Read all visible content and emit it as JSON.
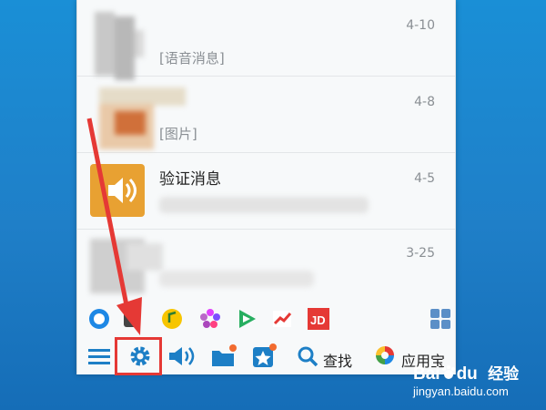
{
  "conversations": [
    {
      "date": "4-10",
      "preview": "[语音消息]"
    },
    {
      "date": "4-8",
      "preview": "[图片]"
    },
    {
      "date": "4-5",
      "title": "验证消息",
      "preview": ""
    },
    {
      "date": "3-25",
      "preview": ""
    }
  ],
  "apps": [
    "qq-browser-icon",
    "music-icon",
    "qq-music-icon",
    "flower-icon",
    "video-icon",
    "stock-icon",
    "jd-icon",
    "app-grid-icon"
  ],
  "toolbar": {
    "search_label": "查找",
    "appstore_label": "应用宝"
  },
  "watermark": {
    "brand": "Bai",
    "brand2": "du",
    "cn": "经验",
    "url": "jingyan.baidu.com"
  },
  "colors": {
    "accent": "#1d7fc6",
    "highlight": "#e53935",
    "verify_bg": "#e8a132"
  }
}
